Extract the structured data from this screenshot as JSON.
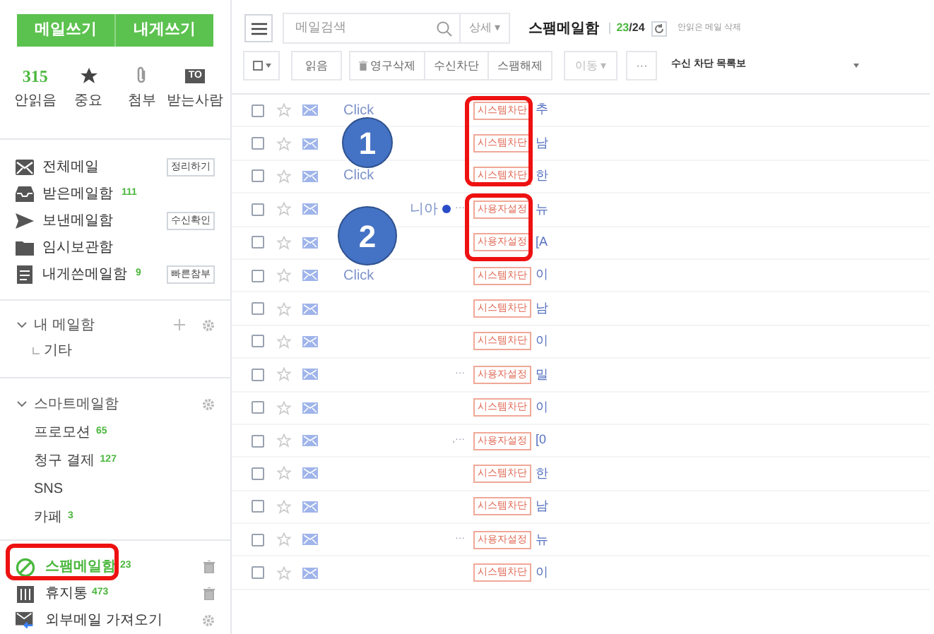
{
  "sidebar": {
    "compose_buttons": [
      "메일쓰기",
      "내게쓰기"
    ],
    "quick_filters": [
      {
        "kind": "count",
        "value": "315",
        "label": "안읽음"
      },
      {
        "kind": "star",
        "label": "중요"
      },
      {
        "kind": "clip",
        "label": "첨부"
      },
      {
        "kind": "to",
        "value": "TO",
        "label": "받는사람"
      }
    ],
    "folders": [
      {
        "label": "전체메일",
        "button": "정리하기"
      },
      {
        "label": "받은메일함",
        "count": "111"
      },
      {
        "label": "보낸메일함",
        "button": "수신확인"
      },
      {
        "label": "임시보관함"
      },
      {
        "label": "내게쓴메일함",
        "count": "9",
        "button": "빠른참부"
      }
    ],
    "my_folders": {
      "label": "내 메일함",
      "expanded": true,
      "children": [
        {
          "label": "기타"
        }
      ]
    },
    "smart_folders": {
      "label": "스마트메일함",
      "expanded": true,
      "children": [
        {
          "label": "프로모션",
          "count": "65"
        },
        {
          "label": "청구 결제",
          "count": "127"
        },
        {
          "label": "SNS"
        },
        {
          "label": "카페",
          "count": "3"
        }
      ]
    },
    "bottom_folders": [
      {
        "label": "스팸메일함",
        "count": "23",
        "selected": true
      },
      {
        "label": "휴지통",
        "count": "473",
        "selected": false
      },
      {
        "label": "외부메일 가져오기",
        "selected": false
      }
    ]
  },
  "toolbar": {
    "search": {
      "placeholder": "메일검색"
    },
    "detail": "상세 ▾",
    "folder_title": "스팸메일함",
    "unread": "23",
    "total": "/24",
    "delete_unread": "안읽은 메일 삭제",
    "actions": [
      "읽음",
      "영구삭제",
      "수신차단",
      "스팸해제"
    ],
    "move": "이동 ▾",
    "more": "···",
    "block_list": "수신 차단 목록보"
  },
  "messages": [
    {
      "checked": false,
      "sender": "Click",
      "tag": "시스템차단",
      "subject": "추"
    },
    {
      "checked": false,
      "tag": "시스템차단",
      "subject": "남"
    },
    {
      "checked": false,
      "sender": "Click",
      "tag": "시스템차단",
      "subject": "한"
    },
    {
      "checked": false,
      "sender": "니아",
      "unread_dot": true,
      "more": "···",
      "tag": "사용자설정",
      "subject": "뉴"
    },
    {
      "checked": false,
      "tag": "사용자설정",
      "subject": "[A"
    },
    {
      "checked": false,
      "sender": "Click",
      "tag": "시스템차단",
      "subject": "이"
    },
    {
      "checked": false,
      "tag": "시스템차단",
      "subject": "남"
    },
    {
      "checked": false,
      "tag": "시스템차단",
      "subject": "이"
    },
    {
      "checked": false,
      "more": "···",
      "tag": "사용자설정",
      "subject": "밀"
    },
    {
      "checked": false,
      "tag": "시스템차단",
      "subject": "이"
    },
    {
      "checked": false,
      "more": ",···",
      "tag": "사용자설정",
      "subject": "[0"
    },
    {
      "checked": false,
      "tag": "시스템차단",
      "subject": "한"
    },
    {
      "checked": false,
      "tag": "시스템차단",
      "subject": "남"
    },
    {
      "checked": false,
      "more": "···",
      "tag": "사용자설정",
      "subject": "뉴"
    },
    {
      "checked": false,
      "tag": "시스템차단",
      "subject": "이"
    }
  ],
  "annotations": [
    {
      "label": "1"
    },
    {
      "label": "2"
    }
  ]
}
